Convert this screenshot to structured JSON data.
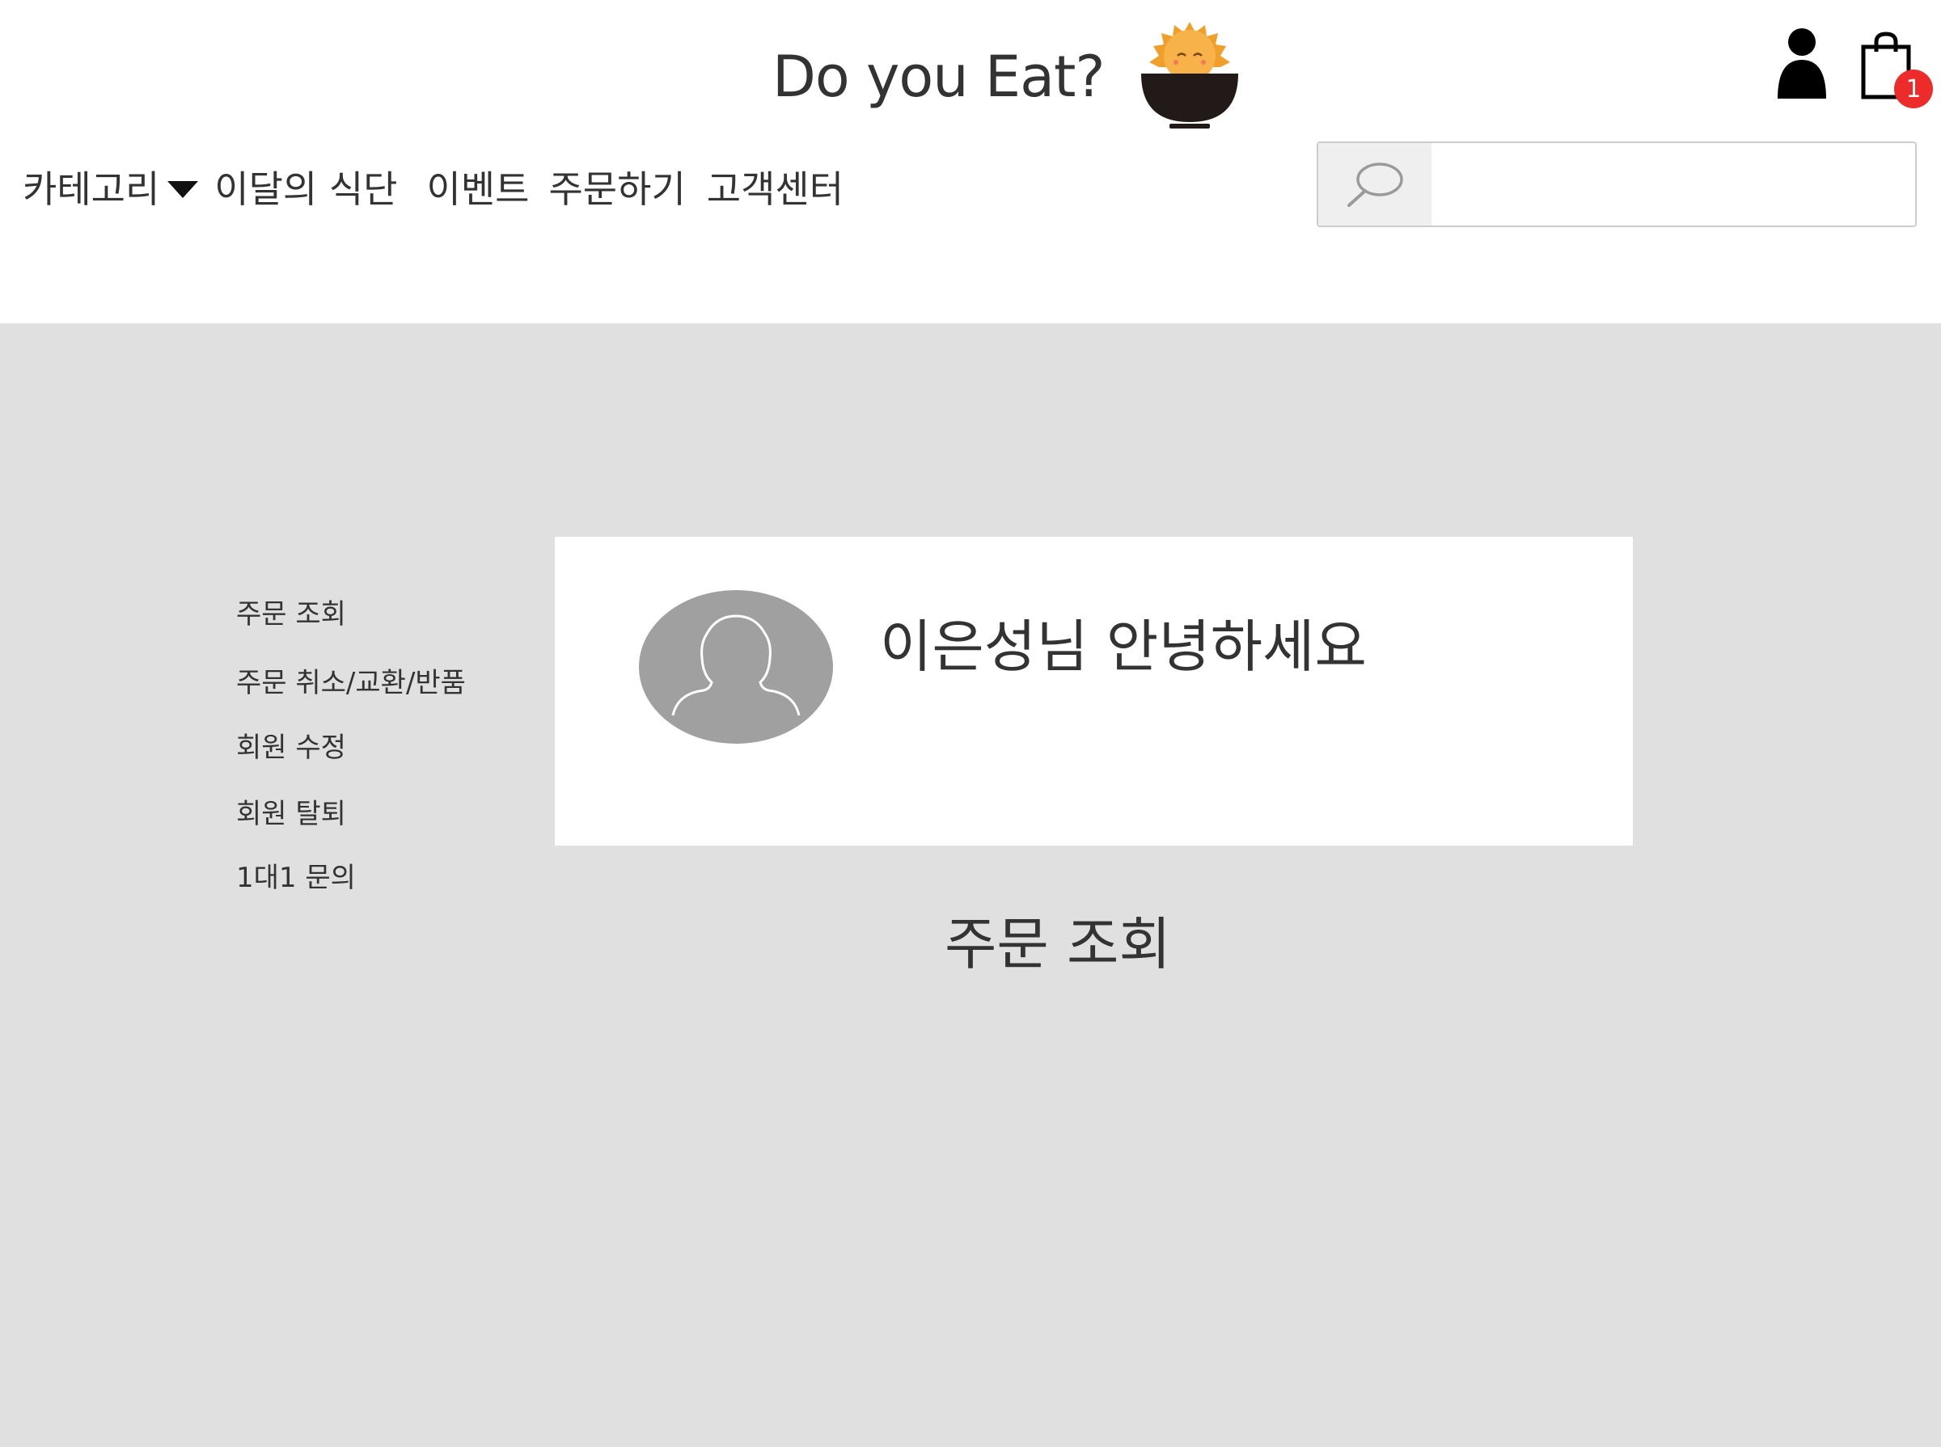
{
  "header": {
    "logo_text": "Do you Eat?",
    "logo_icon": "rice-bowl-sun-icon",
    "user_icon": "user-icon",
    "cart_icon": "shopping-bag-icon",
    "cart_count": "1"
  },
  "nav": {
    "category_label": "카테고리",
    "items": [
      "이달의 식단",
      "이벤트",
      "주문하기",
      "고객센터"
    ]
  },
  "search": {
    "placeholder": "",
    "value": "",
    "icon": "search-icon"
  },
  "sidebar": {
    "items": [
      "주문 조회",
      "주문 취소/교환/반품",
      "회원 수정",
      "회원 탈퇴",
      "1대1 문의"
    ]
  },
  "profile": {
    "greeting": "이은성님 안녕하세요",
    "avatar_icon": "avatar-placeholder-icon"
  },
  "main": {
    "section_title": "주문 조회"
  },
  "colors": {
    "background": "#e0e0e0",
    "card": "#ffffff",
    "text": "#333333",
    "badge": "#ee2b2b",
    "logo_sun": "#f0a02a",
    "logo_bowl": "#221a18",
    "avatar": "#a0a0a0"
  }
}
